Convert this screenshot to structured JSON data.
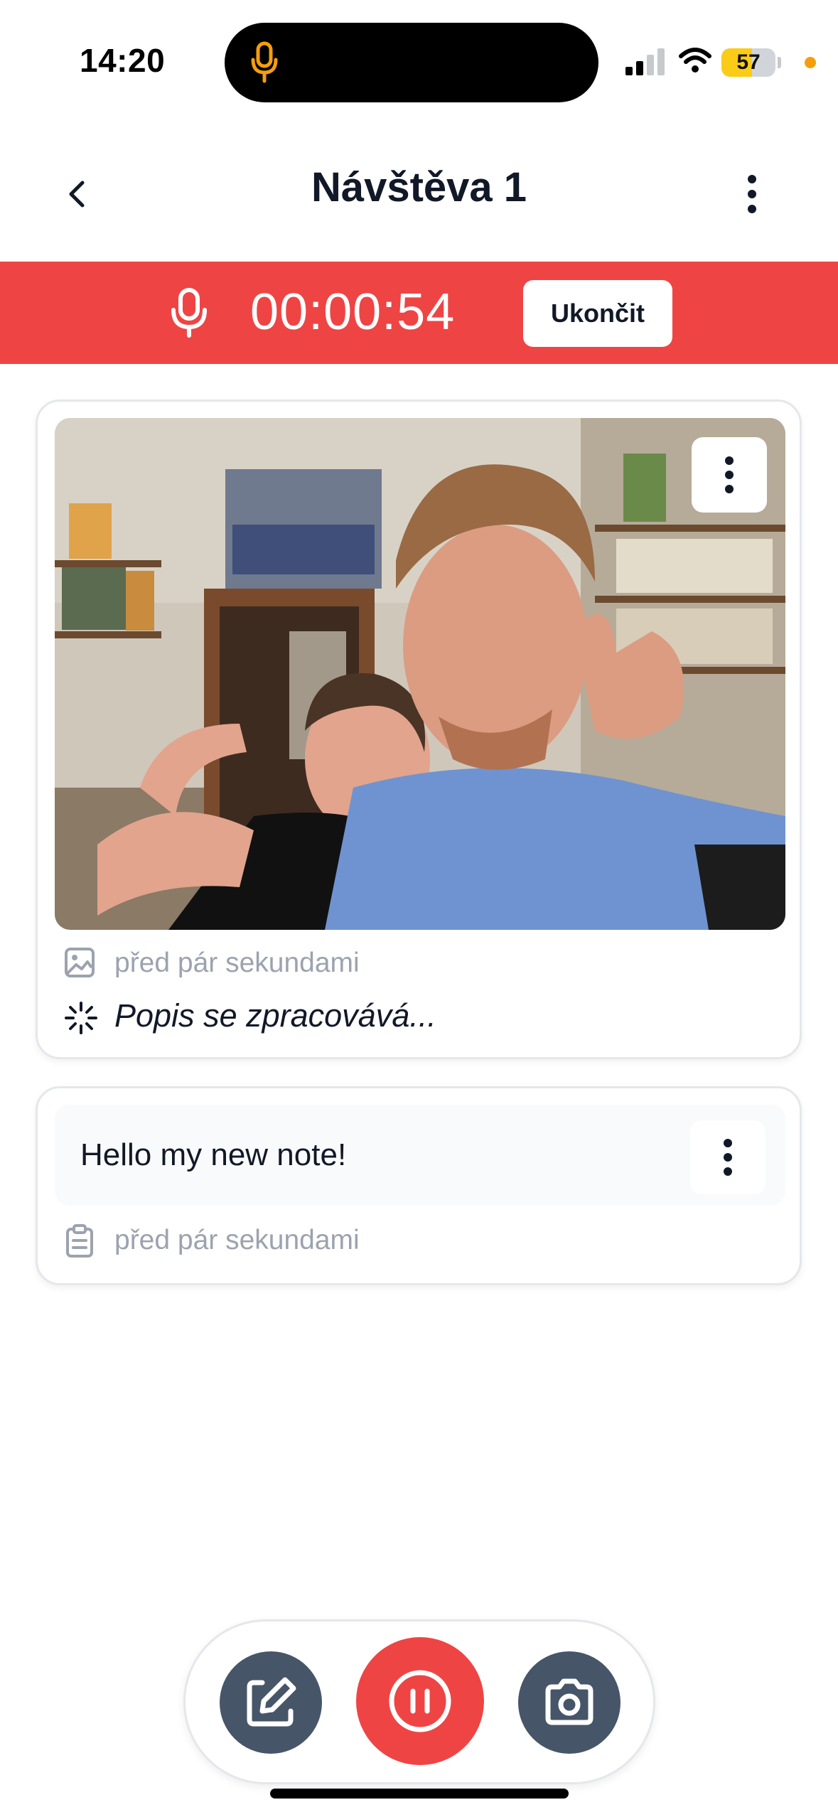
{
  "status_bar": {
    "time": "14:20",
    "battery": "57",
    "battery_level": 0.57
  },
  "header": {
    "title": "Návštěva 1"
  },
  "recording": {
    "timer": "00:00:54",
    "end_label": "Ukončit"
  },
  "photo_card": {
    "timestamp": "před pár sekundami",
    "description": "Popis se zpracovává..."
  },
  "note_card": {
    "text": "Hello my new note!",
    "timestamp": "před pár sekundami"
  },
  "colors": {
    "recording_red": "#ef4444",
    "secondary_button": "#475569",
    "muted_text": "#9ca3af"
  },
  "icons": {
    "status_mic": "microphone-icon",
    "back": "chevron-left-icon",
    "more": "more-vertical-icon",
    "photo": "image-icon",
    "loading": "loader-icon",
    "note": "clipboard-icon",
    "edit": "edit-icon",
    "pause": "pause-icon",
    "camera": "camera-icon"
  }
}
